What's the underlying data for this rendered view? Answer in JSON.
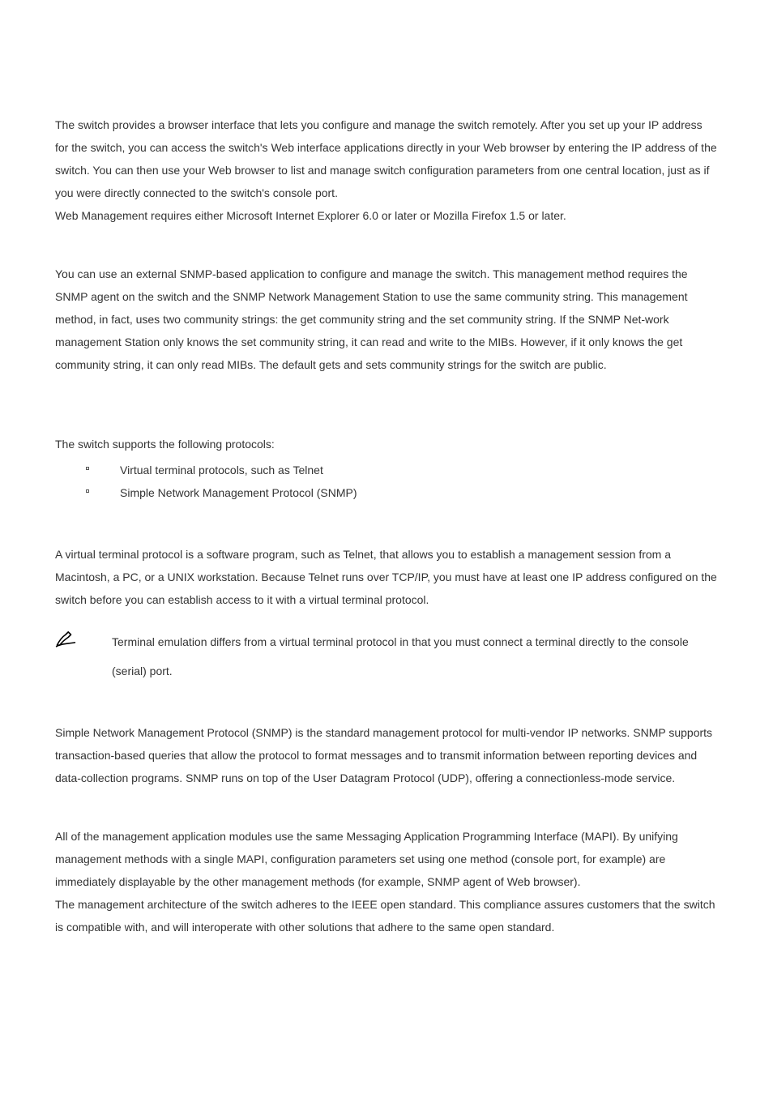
{
  "paragraphs": {
    "p1_intro": "The switch provides a browser interface that lets you configure and manage the switch remotely. After you set up your IP address for the switch, you can access the switch's Web interface applications directly in your Web browser by entering the IP address of the switch. You can then use your Web browser to list and manage switch configuration parameters from one central location, just as if you were directly connected to the switch's console port.",
    "p1_req": "Web Management requires either Microsoft Internet Explorer 6.0 or later or Mozilla Firefox 1.5 or later.",
    "p2_snmp": "You can use an external SNMP-based application to configure and manage the switch. This management method requires the SNMP agent on the switch and the SNMP Network Management Station to use the same community string. This management method, in fact, uses two community strings: the get community string and the set community string. If the SNMP Net-work management Station only knows the set community string, it can read and write to the MIBs. However, if it only knows the get community string, it can only read MIBs. The default gets and sets community strings for the switch are public.",
    "p3_proto_head": "The switch supports the following protocols:",
    "bullets": {
      "b1": "Virtual terminal protocols, such as Telnet",
      "b2": "Simple Network Management Protocol (SNMP)"
    },
    "p4_vt": "A virtual terminal protocol is a software program, such as Telnet, that allows you to establish a management session from a Macintosh, a PC, or a UNIX workstation. Because Telnet runs over TCP/IP, you must have at least one IP address configured on the switch before you can establish access to it with a virtual terminal protocol.",
    "note": "Terminal emulation differs from a virtual terminal protocol in that you must connect a terminal directly to the console (serial) port.",
    "p5_snmp2": "Simple Network Management Protocol (SNMP) is the standard management protocol for multi-vendor IP networks. SNMP supports transaction-based queries that allow the protocol to format messages and to transmit information between reporting devices and data-collection programs. SNMP runs on top of the User Datagram Protocol (UDP), offering a connectionless-mode service.",
    "p6_mapi": "All of the management application modules use the same Messaging Application Programming Interface (MAPI). By unifying management methods with a single MAPI, configuration parameters set using one method (console port, for example) are immediately displayable by the other management methods (for example, SNMP agent of Web browser).",
    "p6_arch": "The management architecture of the switch adheres to the IEEE open standard. This compliance assures customers that the switch is compatible with, and will interoperate with other solutions that adhere to the same open standard."
  }
}
